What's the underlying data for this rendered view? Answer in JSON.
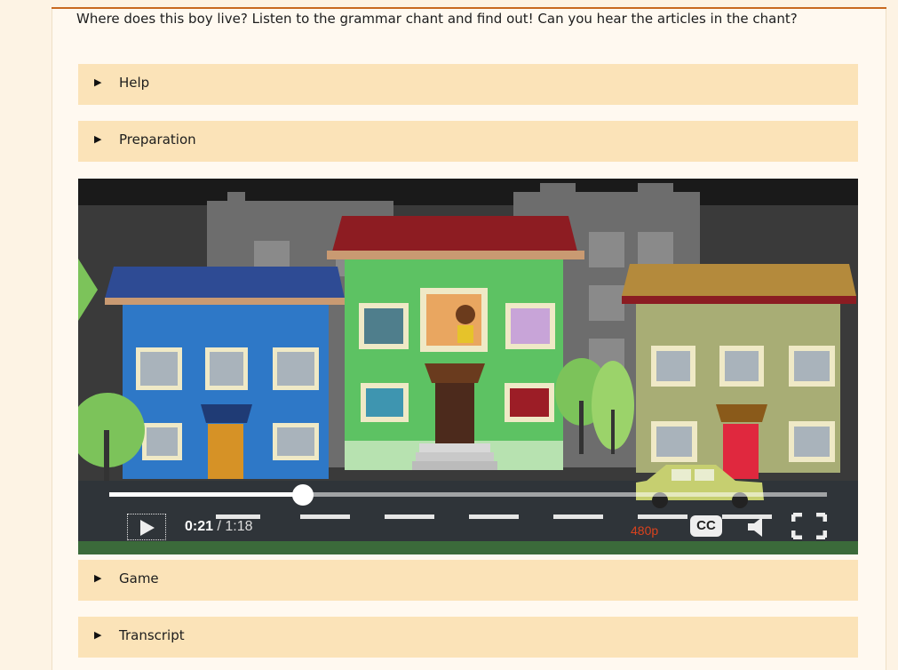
{
  "intro_text": "Where does this boy live? Listen to the grammar chant and find out! Can you hear the articles in the chant?",
  "sections": {
    "help": "Help",
    "preparation": "Preparation",
    "game": "Game",
    "transcript": "Transcript"
  },
  "video": {
    "current_time": "0:21",
    "separator": " / ",
    "duration": "1:18",
    "progress": 0.27,
    "quality": "480p",
    "cc_label": "CC",
    "play_icon": "play-icon",
    "volume_icon": "volume-icon",
    "fullscreen_icon": "fullscreen-icon"
  },
  "colors": {
    "accordion_bg": "#fbe3b8",
    "accent": "#c8691f",
    "quality_text": "#d9421e"
  }
}
